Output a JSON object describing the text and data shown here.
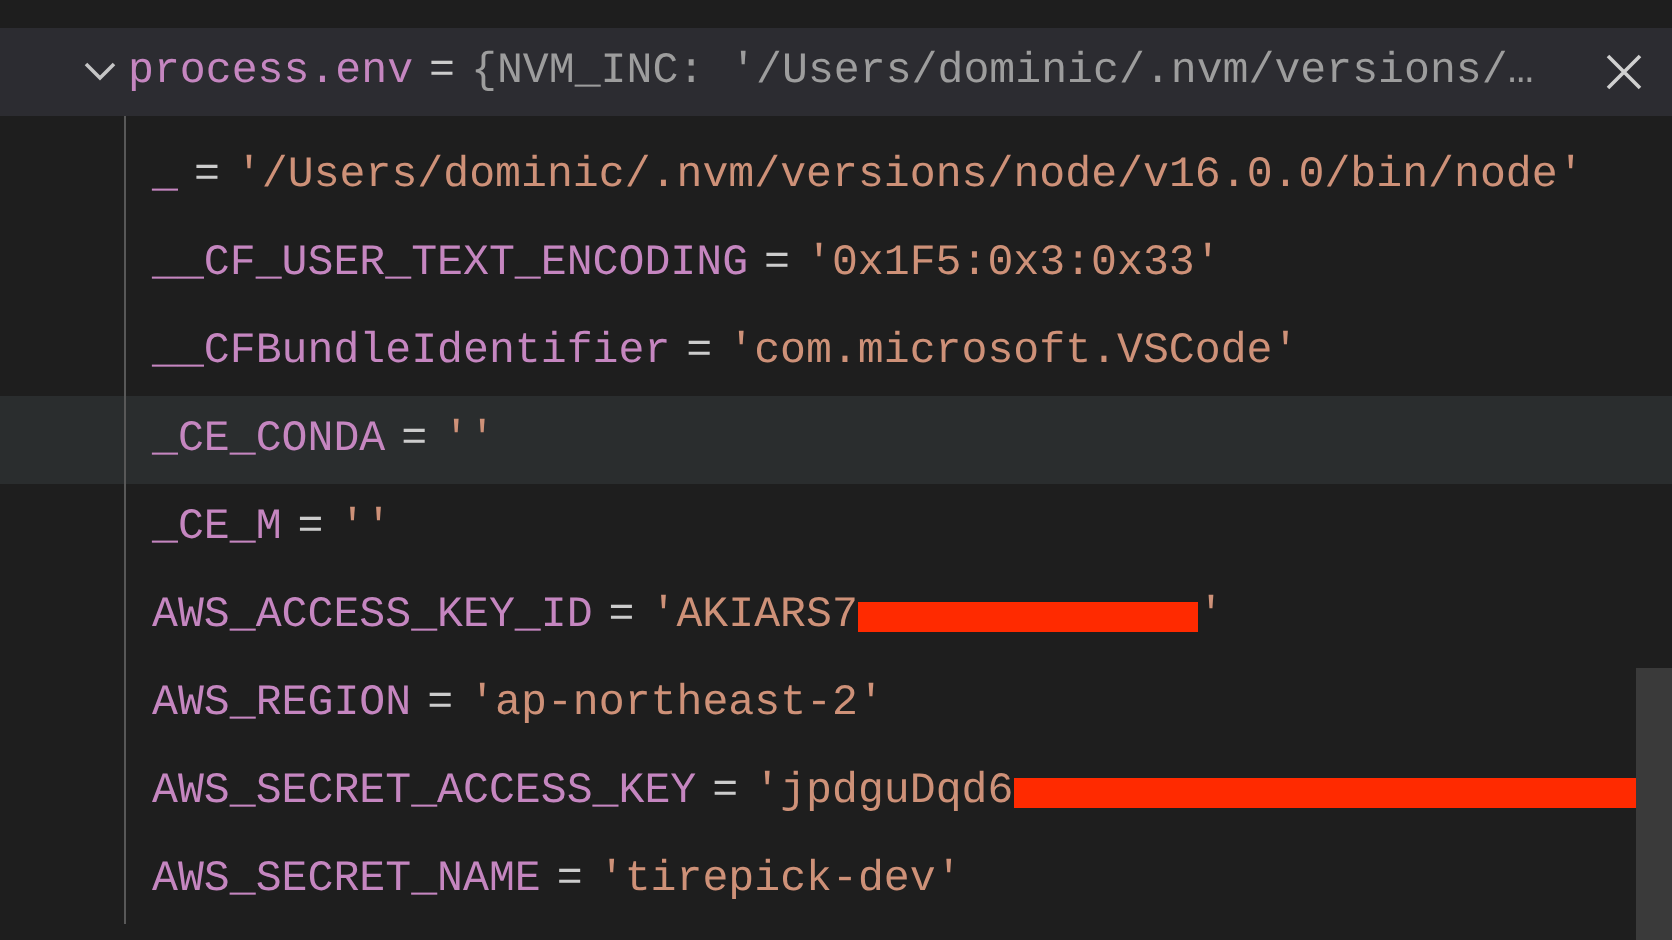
{
  "header": {
    "expanded": true,
    "name": "process.env",
    "operator": "=",
    "preview": "{NVM_INC: '/Users/dominic/.nvm/versions/…"
  },
  "variables": [
    {
      "kind": "plain",
      "name": "_",
      "operator": "=",
      "value": "'/Users/dominic/.nvm/versions/node/v16.0.0/bin/node'",
      "selected": false
    },
    {
      "kind": "plain",
      "name": "__CF_USER_TEXT_ENCODING",
      "operator": "=",
      "value": "'0x1F5:0x3:0x33'",
      "selected": false
    },
    {
      "kind": "plain",
      "name": "__CFBundleIdentifier",
      "operator": "=",
      "value": "'com.microsoft.VSCode'",
      "selected": false
    },
    {
      "kind": "plain",
      "name": "_CE_CONDA",
      "operator": "=",
      "value": "''",
      "selected": true
    },
    {
      "kind": "plain",
      "name": "_CE_M",
      "operator": "=",
      "value": "''",
      "selected": false
    },
    {
      "kind": "redacted",
      "name": "AWS_ACCESS_KEY_ID",
      "operator": "=",
      "value": "'AKIARS7",
      "value_after": "'",
      "selected": false
    },
    {
      "kind": "plain",
      "name": "AWS_REGION",
      "operator": "=",
      "value": "'ap-northeast-2'",
      "selected": false
    },
    {
      "kind": "redacted",
      "name": "AWS_SECRET_ACCESS_KEY",
      "operator": "=",
      "value": "'jpdguDqd6",
      "selected": false
    },
    {
      "kind": "plain",
      "name": "AWS_SECRET_NAME",
      "operator": "=",
      "value": "'tirepick-dev'",
      "selected": false
    }
  ]
}
